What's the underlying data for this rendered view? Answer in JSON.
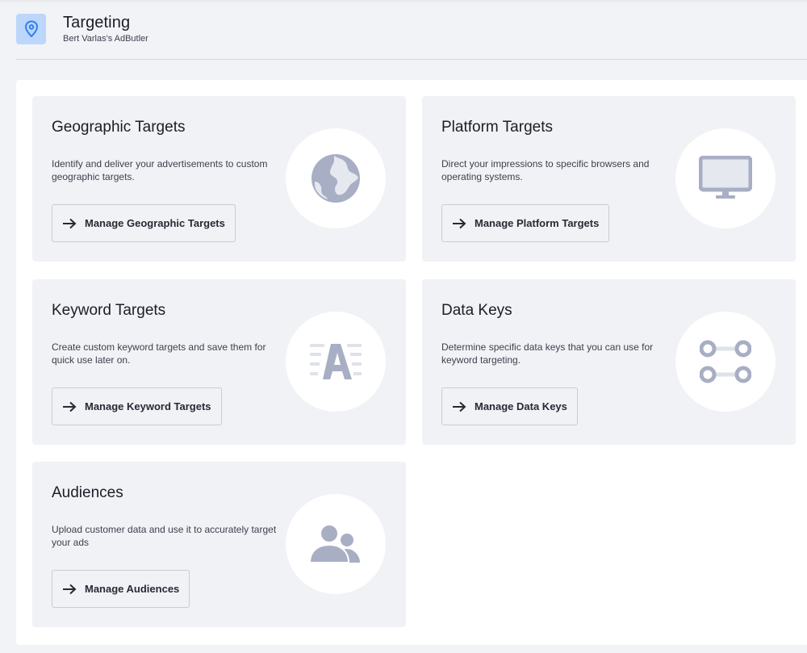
{
  "header": {
    "title": "Targeting",
    "subtitle": "Bert Varlas's AdButler",
    "icon": "location-pin-icon"
  },
  "colors": {
    "accent": "#2f7ff0",
    "icon_tile": "#bdd6fb",
    "illustration": "#a8aec4",
    "card_bg": "#f1f2f5"
  },
  "cards": [
    {
      "title": "Geographic Targets",
      "description": "Identify and deliver your advertisements to custom geographic targets.",
      "button_label": "Manage Geographic Targets",
      "icon": "globe-icon"
    },
    {
      "title": "Platform Targets",
      "description": "Direct your impressions to specific browsers and operating systems.",
      "button_label": "Manage Platform Targets",
      "icon": "monitor-icon"
    },
    {
      "title": "Keyword Targets",
      "description": "Create custom keyword targets and save them for quick use later on.",
      "button_label": "Manage Keyword Targets",
      "icon": "keyword-letter-icon"
    },
    {
      "title": "Data Keys",
      "description": "Determine specific data keys that you can use for keyword targeting.",
      "button_label": "Manage Data Keys",
      "icon": "data-keys-icon"
    },
    {
      "title": "Audiences",
      "description": "Upload customer data and use it to accurately target your ads",
      "button_label": "Manage Audiences",
      "icon": "users-icon"
    }
  ]
}
